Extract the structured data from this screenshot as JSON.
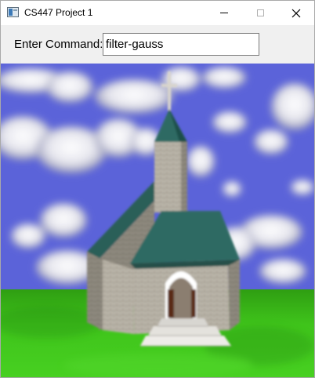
{
  "window": {
    "title": "CS447 Project 1",
    "icon": "app-window-icon",
    "controls": [
      "minimize-icon",
      "maximize-icon",
      "close-icon"
    ]
  },
  "command": {
    "label": "Enter Command:",
    "value": "filter-gauss"
  },
  "scene": {
    "description_icon": "church-scene",
    "colors": {
      "sky": "#5a63d8",
      "cloud": "#ffffff",
      "grass": "#3ec41a",
      "roof": "#2f6b63",
      "stone": "#b5b0a4"
    }
  }
}
